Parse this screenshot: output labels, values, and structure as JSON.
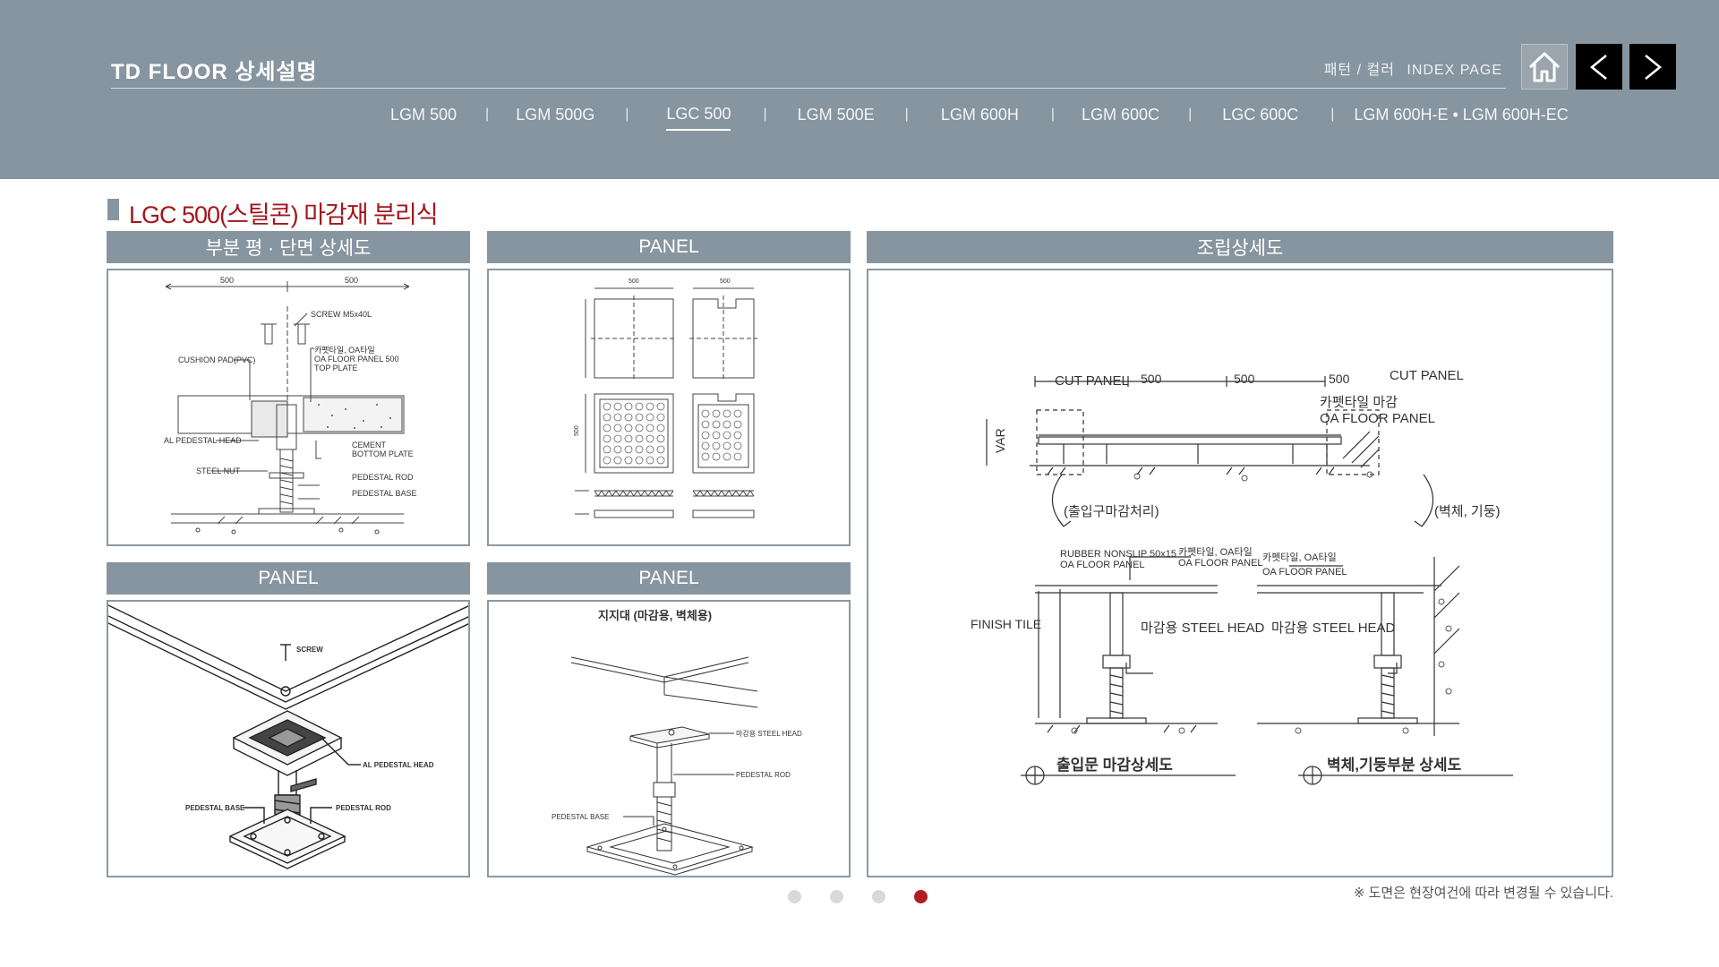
{
  "header": {
    "title": "TD FLOOR 상세설명",
    "links": {
      "pattern_color": "패턴 / 컬러",
      "index_page": "INDEX PAGE"
    },
    "nav_tabs": [
      {
        "label": "LGM 500",
        "active": false
      },
      {
        "label": "LGM 500G",
        "active": false
      },
      {
        "label": "LGC 500",
        "active": true
      },
      {
        "label": "LGM 500E",
        "active": false
      },
      {
        "label": "LGM 600H",
        "active": false
      },
      {
        "label": "LGM 600C",
        "active": false
      },
      {
        "label": "LGC 600C",
        "active": false
      },
      {
        "label": "LGM 600H-E • LGM 600H-EC",
        "active": false
      }
    ],
    "tab_separator": "|",
    "icons": {
      "home": "home-icon",
      "prev": "chevron-left-icon",
      "next": "chevron-right-icon"
    }
  },
  "section": {
    "title": "LGC 500(스틸콘) 마감재 분리식"
  },
  "panels": {
    "p1": {
      "title": "부분 평 · 단면 상세도",
      "labels": {
        "dim_a": "500",
        "dim_b": "500",
        "screw": "SCREW M5x40L",
        "cushion": "CUSHION PAD(PVC)",
        "carpet": "카펫타일, OA타일",
        "oa_panel": "OA FLOOR PANEL 500",
        "top_plate": "TOP PLATE",
        "al_head": "AL PEDESTAL HEAD",
        "cement": "CEMENT",
        "bottom_plate": "BOTTOM PLATE",
        "steel_nut": "STEEL NUT",
        "rod": "PEDESTAL ROD",
        "base": "PEDESTAL BASE"
      }
    },
    "p2": {
      "title": "PANEL",
      "labels": {
        "dim_500": "500",
        "dim_500b": "500",
        "dim_side": "500"
      }
    },
    "p3": {
      "title": "조립상세도",
      "labels": {
        "cut_panel_left": "CUT PANEL",
        "cut_panel_right": "CUT PANEL",
        "d1": "500",
        "d2": "500",
        "d3": "500",
        "carpet_finish": "카펫타일 마감",
        "oa_panel": "OA FLOOR PANEL",
        "var": "VAR",
        "entrance_finish": "(출입구마감처리)",
        "wall_column": "(벽체, 기둥)",
        "rubber": "RUBBER NONSLIP 50x15",
        "oa_panel_2": "OA FLOOR PANEL",
        "carpet_oa": "카펫타일, OA타일",
        "oa_panel_3": "OA FLOOR PANEL",
        "carpet_oa_2": "카펫타일, OA타일",
        "oa_panel_4": "OA FLOOR PANEL",
        "finish_tile": "FINISH TILE",
        "steel_head_1": "마감용 STEEL HEAD",
        "steel_head_2": "마감용 STEEL HEAD",
        "caption_entrance": "출입문 마감상세도",
        "caption_wall": "벽체,기둥부분 상세도"
      }
    },
    "p4": {
      "title": "PANEL",
      "labels": {
        "screw": "SCREW",
        "al_head": "AL PEDESTAL HEAD",
        "base": "PEDESTAL BASE",
        "rod": "PEDESTAL ROD"
      }
    },
    "p5": {
      "title": "PANEL",
      "labels": {
        "subtitle": "지지대 (마감용, 벽체용)",
        "steel_head": "마감용 STEEL HEAD",
        "rod": "PEDESTAL ROD",
        "base": "PEDESTAL BASE"
      }
    }
  },
  "pagination": {
    "count": 4,
    "active_index": 3
  },
  "footer_note": "※ 도면은 현장여건에 따라 변경될 수 있습니다.",
  "colors": {
    "header_bg": "#8795a0",
    "accent_red": "#a3161d",
    "dot_active": "#b01e23",
    "dot_inactive": "#d7d9db"
  }
}
